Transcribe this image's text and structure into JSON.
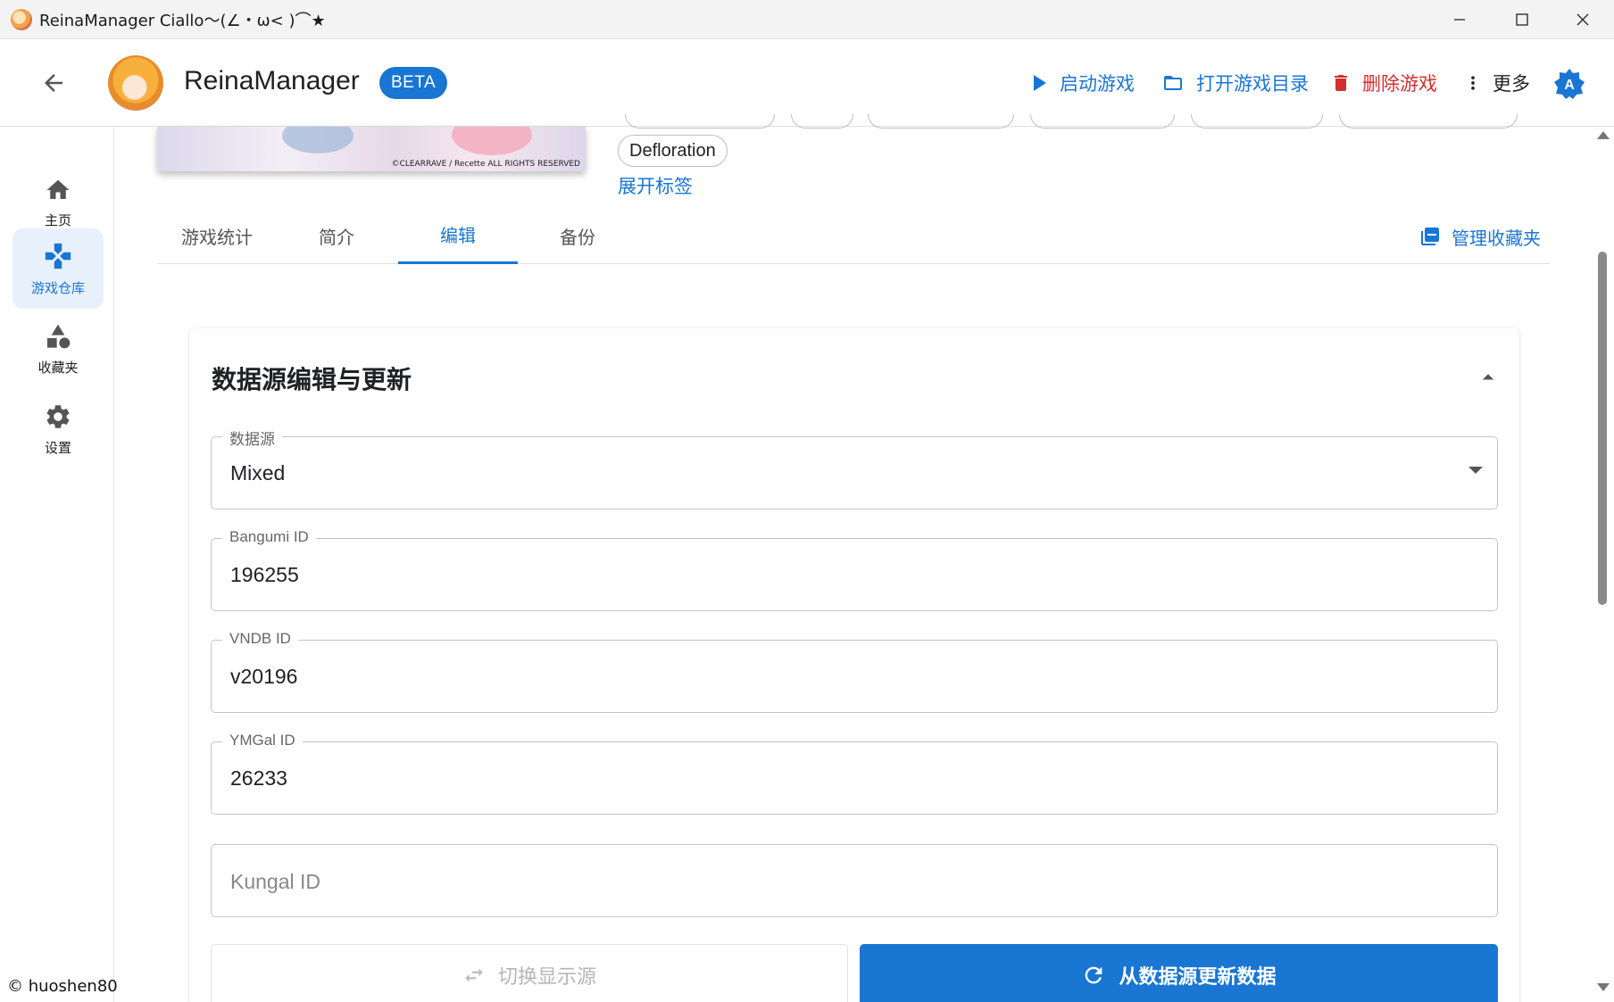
{
  "window": {
    "title": "ReinaManager Ciallo～(∠・ω< )⌒★"
  },
  "appbar": {
    "brand": "ReinaManager",
    "badge": "BETA",
    "actions": {
      "launch": "启动游戏",
      "open_dir": "打开游戏目录",
      "delete": "删除游戏",
      "more": "更多"
    },
    "avatar_letter": "A"
  },
  "sidebar": {
    "items": [
      {
        "label": "主页",
        "icon": "home-icon"
      },
      {
        "label": "游戏仓库",
        "icon": "gamepad-icon",
        "active": true
      },
      {
        "label": "收藏夹",
        "icon": "category-icon"
      },
      {
        "label": "设置",
        "icon": "gear-icon"
      }
    ],
    "copyright": "© huoshen80"
  },
  "cover": {
    "credit": "©CLEARRAVE / Recette ALL RIGHTS RESERVED"
  },
  "tags": {
    "visible_tag": "Defloration",
    "expand_label": "展开标签"
  },
  "tabs": [
    {
      "label": "游戏统计"
    },
    {
      "label": "简介"
    },
    {
      "label": "编辑",
      "active": true
    },
    {
      "label": "备份"
    }
  ],
  "manage_favorites": "管理收藏夹",
  "edit_card": {
    "title": "数据源编辑与更新",
    "fields": {
      "data_source": {
        "label": "数据源",
        "value": "Mixed"
      },
      "bangumi": {
        "label": "Bangumi ID",
        "value": "196255"
      },
      "vndb": {
        "label": "VNDB ID",
        "value": "v20196"
      },
      "ymgal": {
        "label": "YMGal ID",
        "value": "26233"
      },
      "kungal": {
        "placeholder": "Kungal ID",
        "value": ""
      }
    },
    "buttons": {
      "switch_source": "切换显示源",
      "update_from_source": "从数据源更新数据"
    }
  },
  "colors": {
    "accent": "#1976d2",
    "danger": "#d32f2f",
    "nav_active_bg": "#e8f0fb"
  }
}
